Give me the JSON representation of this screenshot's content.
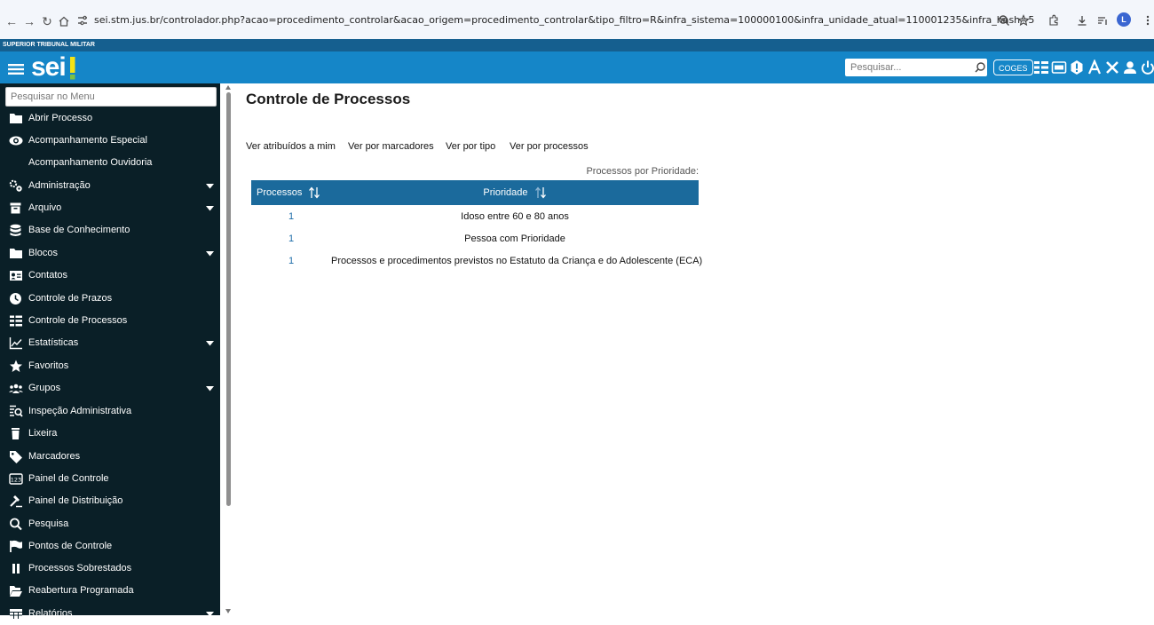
{
  "browser": {
    "url": "sei.stm.jus.br/controlador.php?acao=procedimento_controlar&acao_origem=procedimento_controlar&tipo_filtro=R&infra_sistema=100000100&infra_unidade_atual=110001235&infra_hash=550f94bdfa530b9cb69c046e14c4ed69e6...",
    "profile_initial": "L",
    "icons": [
      "back-icon",
      "forward-icon",
      "reload-icon",
      "home-icon",
      "site-info-icon",
      "zoom-icon",
      "bookmark-star-icon",
      "extensions-icon",
      "downloads-icon",
      "reading-list-icon",
      "more-icon"
    ]
  },
  "app": {
    "organization": "SUPERIOR TRIBUNAL MILITAR",
    "logo_text": "sei",
    "search_placeholder": "Pesquisar...",
    "unit_label": "COGES",
    "accent_color": "#1586c8",
    "header_color": "#155f8f",
    "sidebar_color": "#0a1f27"
  },
  "sidebar": {
    "search_placeholder": "Pesquisar no Menu",
    "items": [
      {
        "label": "Abrir Processo",
        "icon": "folder-icon",
        "has_submenu": false
      },
      {
        "label": "Acompanhamento Especial",
        "icon": "eye-icon",
        "has_submenu": false
      },
      {
        "label": "Acompanhamento Ouvidoria",
        "icon": "",
        "has_submenu": false
      },
      {
        "label": "Administração",
        "icon": "gears-icon",
        "has_submenu": true
      },
      {
        "label": "Arquivo",
        "icon": "archive-icon",
        "has_submenu": true
      },
      {
        "label": "Base de Conhecimento",
        "icon": "database-icon",
        "has_submenu": false
      },
      {
        "label": "Blocos",
        "icon": "blocks-folder-icon",
        "has_submenu": true
      },
      {
        "label": "Contatos",
        "icon": "contact-card-icon",
        "has_submenu": false
      },
      {
        "label": "Controle de Prazos",
        "icon": "clock-icon",
        "has_submenu": false
      },
      {
        "label": "Controle de Processos",
        "icon": "list-icon",
        "has_submenu": false
      },
      {
        "label": "Estatísticas",
        "icon": "chart-line-icon",
        "has_submenu": true
      },
      {
        "label": "Favoritos",
        "icon": "star-icon",
        "has_submenu": false
      },
      {
        "label": "Grupos",
        "icon": "users-icon",
        "has_submenu": true
      },
      {
        "label": "Inspeção Administrativa",
        "icon": "inspection-icon",
        "has_submenu": false
      },
      {
        "label": "Lixeira",
        "icon": "trash-icon",
        "has_submenu": false
      },
      {
        "label": "Marcadores",
        "icon": "tag-icon",
        "has_submenu": false
      },
      {
        "label": "Painel de Controle",
        "icon": "numbers-icon",
        "has_submenu": false
      },
      {
        "label": "Painel de Distribuição",
        "icon": "gavel-icon",
        "has_submenu": false
      },
      {
        "label": "Pesquisa",
        "icon": "search-icon",
        "has_submenu": false
      },
      {
        "label": "Pontos de Controle",
        "icon": "flag-icon",
        "has_submenu": false
      },
      {
        "label": "Processos Sobrestados",
        "icon": "pause-icon",
        "has_submenu": false
      },
      {
        "label": "Reabertura Programada",
        "icon": "reopen-folder-icon",
        "has_submenu": false
      },
      {
        "label": "Relatórios",
        "icon": "table-icon",
        "has_submenu": true
      }
    ]
  },
  "main": {
    "title": "Controle de Processos",
    "view_links": [
      "Ver atribuídos a mim",
      "Ver por marcadores",
      "Ver por tipo",
      "Ver por processos"
    ],
    "table": {
      "caption": "Processos por Prioridade:",
      "columns": [
        "Processos",
        "Prioridade"
      ],
      "rows": [
        {
          "count": "1",
          "priority": "Idoso entre 60 e 80 anos"
        },
        {
          "count": "1",
          "priority": "Pessoa com Prioridade"
        },
        {
          "count": "1",
          "priority": "Processos e procedimentos previstos no Estatuto da Criança e do Adolescente (ECA)"
        }
      ]
    }
  }
}
